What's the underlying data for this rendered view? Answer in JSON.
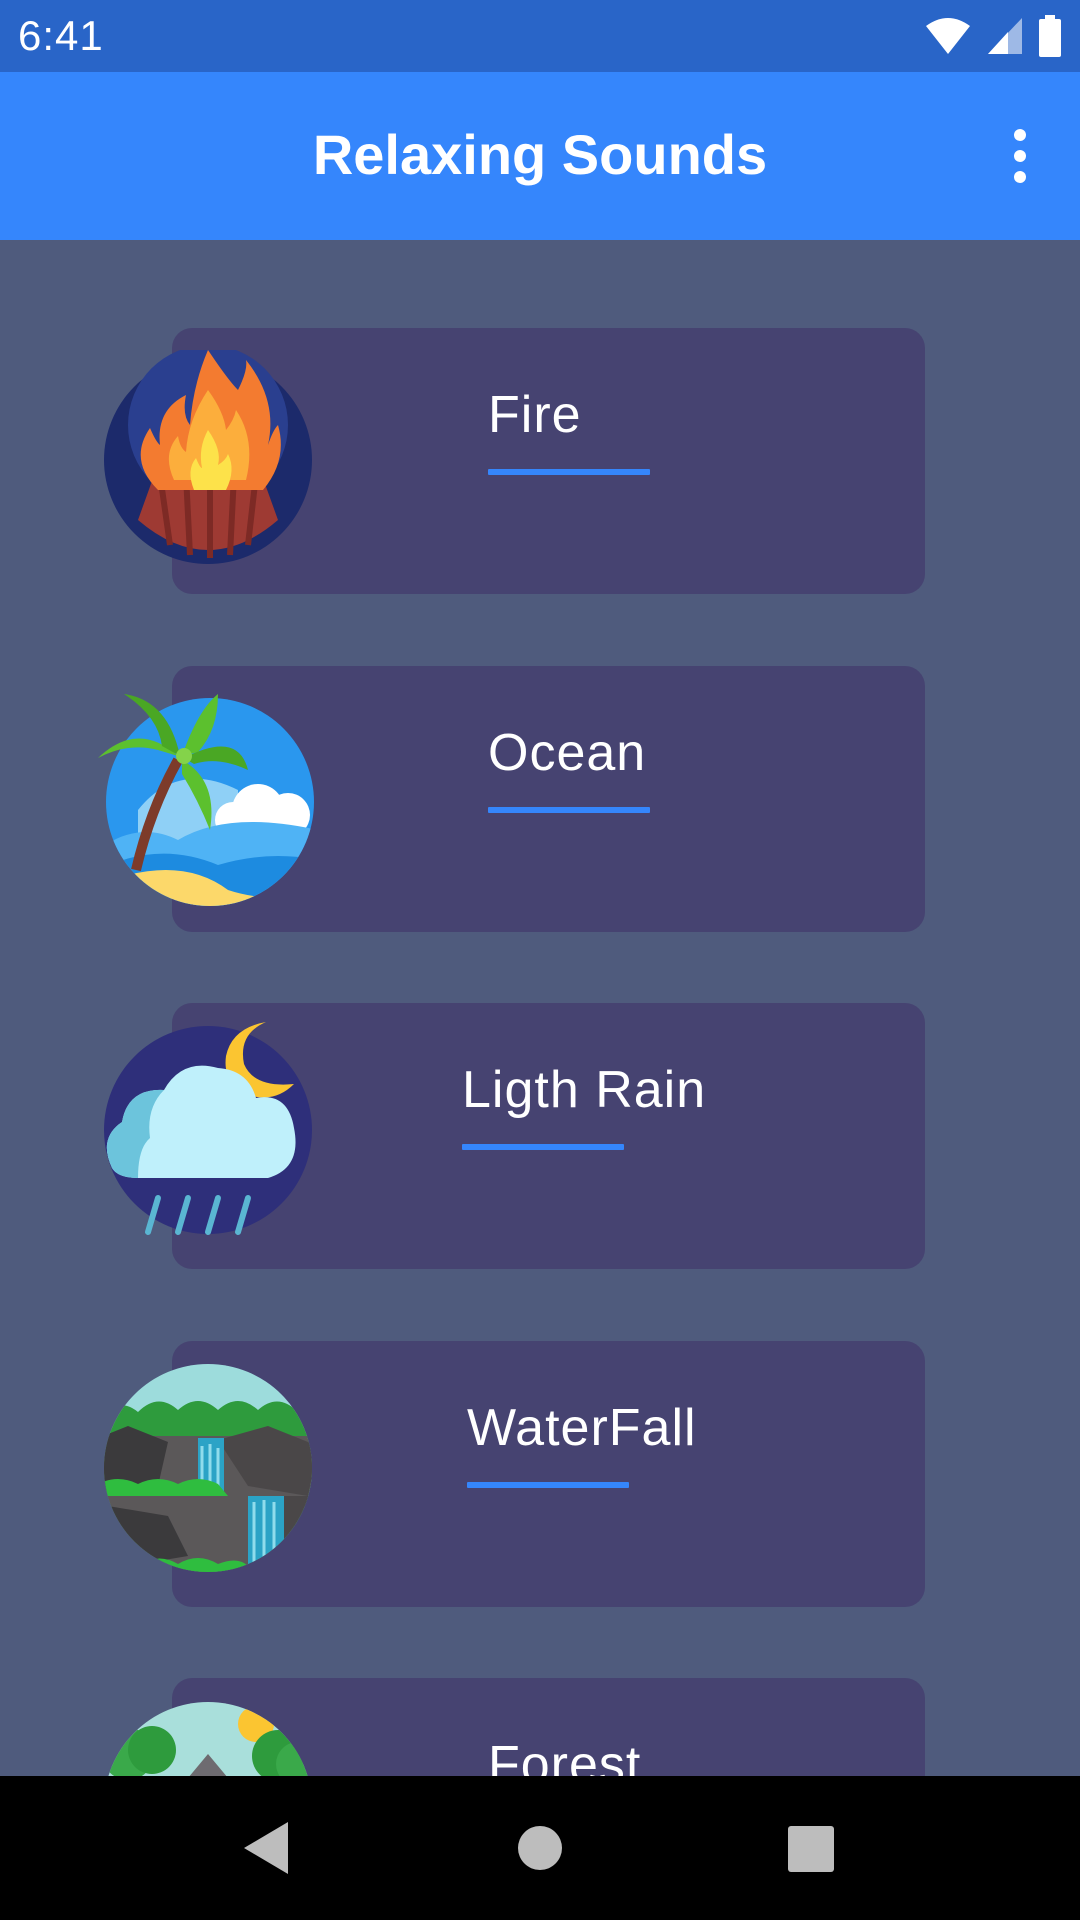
{
  "status_bar": {
    "time": "6:41",
    "icons": [
      "wifi-icon",
      "signal-icon",
      "battery-icon"
    ]
  },
  "app_bar": {
    "title": "Relaxing Sounds",
    "menu_icon": "more-vert-icon"
  },
  "colors": {
    "status_bar": "#2965c8",
    "app_bar": "#3586fc",
    "background": "#4f5b7d",
    "card": "#464371",
    "accent": "#3586fc"
  },
  "sounds": [
    {
      "label": "Fire",
      "icon": "fire-icon"
    },
    {
      "label": "Ocean",
      "icon": "ocean-icon"
    },
    {
      "label": "Ligth Rain",
      "icon": "rain-icon"
    },
    {
      "label": "WaterFall",
      "icon": "waterfall-icon"
    },
    {
      "label": "Forest",
      "icon": "forest-icon"
    }
  ],
  "nav_bar": {
    "icons": [
      "back-icon",
      "home-icon",
      "recents-icon"
    ]
  }
}
